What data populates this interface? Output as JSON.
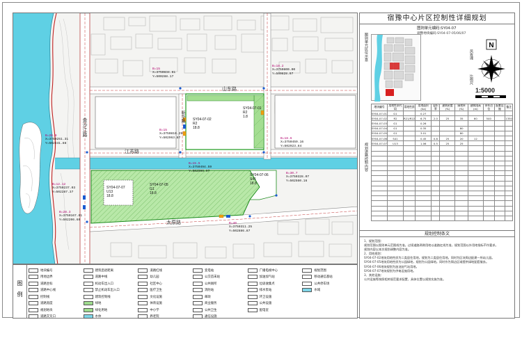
{
  "title": "宿豫中心片区控制性详细规划",
  "map_number": "图则单元编码:SY04-07",
  "map_date": "调整地块编码:SY04-07-05/06/07",
  "location_label": "图则单元区位示意",
  "north_label": "风玫瑰",
  "scale_label": "比例尺",
  "scale": "1:5000",
  "road_diagram_label": "规划道路控制内容",
  "roads": {
    "upper": "山东路",
    "middle": "江苏路",
    "lower": "太原路",
    "left_vertical": "金沙江路",
    "mid_vertical": "新华路"
  },
  "plots": [
    {
      "id": "SY04-07-01",
      "code": "R2",
      "far": "1.8"
    },
    {
      "id": "SY04-07-02",
      "code": "R2",
      "far": "18.8"
    },
    {
      "id": "SY04-07-05",
      "code": "G1",
      "far": "18.8"
    },
    {
      "id": "SY04-07-07",
      "code": "U13",
      "far": "18.8"
    },
    {
      "id": "SY04-07-06",
      "code": "S41",
      "far": "18.8"
    }
  ],
  "road_widths": [
    "B=15",
    "B=28",
    "B=15",
    "B=10",
    "B=28"
  ],
  "coords": [
    {
      "cn": "B=15",
      "x": "X=3750834.61",
      "y": "Y=500288.17"
    },
    {
      "cn": "B=15",
      "x": "X=3750810.29",
      "y": "Y=502963.87"
    },
    {
      "cn": "B=18.2",
      "x": "X=3750800.00",
      "y": "Y=500828.07"
    },
    {
      "cn": "B=28.9",
      "x": "X=3750251.31",
      "y": "Y=502241.88"
    },
    {
      "cn": "B=18.6",
      "x": "X=3750459.16",
      "y": "Y=502923.84"
    },
    {
      "cn": "B=15.5",
      "x": "X=3750494.59",
      "y": "Y=502596.97"
    },
    {
      "cn": "B=30.7",
      "x": "X=3750328.07",
      "y": "Y=502560.16"
    },
    {
      "cn": "B=12.12",
      "x": "X=3750237.03",
      "y": "Y=502287.37"
    },
    {
      "cn": "B=28.3",
      "x": "X=3750167.01",
      "y": "Y=502206.60"
    },
    {
      "cn": "B=40",
      "x": "X=3750311.25",
      "y": "Y=502886.87"
    }
  ],
  "table": {
    "headers": [
      "地块编号",
      "用地性质代码",
      "用地性质",
      "用地面积(ha)",
      "容积率",
      "建筑密度(%)",
      "绿地率(%)",
      "建筑限高(m)",
      "停车泊位",
      "配套设施",
      "备注"
    ],
    "rows": [
      [
        "SY04-07-01",
        "G1",
        "",
        "0.27",
        "",
        "",
        "",
        "",
        "",
        "",
        ""
      ],
      [
        "SY04-07-02",
        "R2",
        "R21/R22",
        "6.75",
        "2.0",
        "25",
        "35",
        "60",
        "540",
        "",
        "1350"
      ],
      [
        "SY04-07-03",
        "G1",
        "",
        "0.26",
        "",
        "",
        "",
        "",
        "",
        "",
        ""
      ],
      [
        "SY04-07-04",
        "G1",
        "",
        "0.35",
        "",
        "",
        "80",
        "",
        "",
        "",
        ""
      ],
      [
        "SY04-07-05",
        "G1",
        "",
        "3.01",
        "",
        "",
        "80",
        "",
        "",
        "",
        ""
      ],
      [
        "SY04-07-06",
        "S41",
        "",
        "0.45",
        "0.8",
        "25",
        "20",
        "12",
        "",
        "",
        ""
      ],
      [
        "SY04-07-07",
        "U13",
        "",
        "1.06",
        "0.5",
        "25",
        "25",
        "",
        "",
        "",
        ""
      ],
      [
        "",
        "",
        "",
        "",
        "",
        "",
        "",
        "",
        "",
        "",
        ""
      ],
      [
        "",
        "",
        "",
        "",
        "",
        "",
        "",
        "",
        "",
        "",
        ""
      ],
      [
        "",
        "",
        "",
        "",
        "",
        "",
        "",
        "",
        "",
        "",
        ""
      ],
      [
        "",
        "",
        "",
        "",
        "",
        "",
        "",
        "",
        "",
        "",
        ""
      ],
      [
        "",
        "",
        "",
        "",
        "",
        "",
        "",
        "",
        "",
        "",
        ""
      ],
      [
        "",
        "",
        "",
        "",
        "",
        "",
        "",
        "",
        "",
        "",
        ""
      ],
      [
        "",
        "",
        "",
        "",
        "",
        "",
        "",
        "",
        "",
        "",
        ""
      ],
      [
        "",
        "",
        "",
        "",
        "",
        "",
        "",
        "",
        "",
        "",
        ""
      ],
      [
        "",
        "",
        "",
        "",
        "",
        "",
        "",
        "",
        "",
        "",
        ""
      ],
      [
        "",
        "",
        "",
        "",
        "",
        "",
        "",
        "",
        "",
        "",
        ""
      ],
      [
        "",
        "",
        "",
        "",
        "",
        "",
        "",
        "",
        "",
        "",
        ""
      ],
      [
        "",
        "",
        "",
        "",
        "",
        "",
        "",
        "",
        "",
        "",
        ""
      ],
      [
        "",
        "",
        "",
        "",
        "",
        "",
        "",
        "",
        "",
        "",
        ""
      ],
      [
        "",
        "",
        "",
        "",
        "",
        "",
        "",
        "",
        "",
        "",
        ""
      ],
      [
        "",
        "",
        "",
        "",
        "",
        "",
        "",
        "",
        "",
        "",
        ""
      ]
    ]
  },
  "control_title": "规划控制条文",
  "notes": [
    "1、规划范围：",
    "   规划范围以图则单元范围线为准。过境道路两侧用地以道路红线为准，规划范围以外用地指标不作要求。",
    "   规划内容以本次规划调整内容为准。",
    "2、用地规划：",
    "   SY04-07-02地块用地性质为二类居住用地，规划为二类居住用地。同时为区块周边配建一所幼儿园。",
    "   SY04-07-05地块用地性质为公园绿地，规划为公园绿地。同时作为周边区域提供绿地配套服务。",
    "   SY04-07-06地块规划为加油加气站用地。",
    "   SY04-07-07地块规划为供电设施用地。",
    "3、其他设施：",
    "   公共设施等按照相关规范要求配置，具体位置以规划实施为准。"
  ],
  "legend_title": "图例",
  "legend": [
    {
      "label": "地块编号",
      "color": "#ffffff"
    },
    {
      "label": "建筑后退距离",
      "color": "#ffffff"
    },
    {
      "label": "道路红线",
      "color": "#ffffff"
    },
    {
      "label": "变电站",
      "color": "#ffffff"
    },
    {
      "label": "广播电视中心",
      "color": "#ffffff"
    },
    {
      "label": "规划范围",
      "color": "#ffffff"
    },
    {
      "label": "用地边界",
      "color": "#ffffff"
    },
    {
      "label": "道路中线",
      "color": "#ffffff"
    },
    {
      "label": "幼儿园",
      "color": "#ffffff"
    },
    {
      "label": "公交首末站",
      "color": "#ffffff"
    },
    {
      "label": "加油加气站",
      "color": "#ffffff"
    },
    {
      "label": "移动通信基站",
      "color": "#ffffff"
    },
    {
      "label": "道路坐标",
      "color": "#ffffff"
    },
    {
      "label": "机动车出入口",
      "color": "#ffffff"
    },
    {
      "label": "社区中心",
      "color": "#ffffff"
    },
    {
      "label": "公共厕所",
      "color": "#ffffff"
    },
    {
      "label": "垃圾收集点",
      "color": "#ffffff"
    },
    {
      "label": "公共停车场",
      "color": "#ffffff"
    },
    {
      "label": "道路中心线",
      "color": "#ffffff"
    },
    {
      "label": "禁止机动车出入口",
      "color": "#ffffff"
    },
    {
      "label": "医疗卫生",
      "color": "#ffffff"
    },
    {
      "label": "消防站",
      "color": "#ffffff"
    },
    {
      "label": "排水泵站",
      "color": "#ffffff"
    },
    {
      "label": "水域",
      "color": "#7fd6e8"
    },
    {
      "label": "控制线",
      "color": "#ffffff"
    },
    {
      "label": "建筑控制线",
      "color": "#ffffff"
    },
    {
      "label": "文化设施",
      "color": "#ffffff"
    },
    {
      "label": "邮政",
      "color": "#ffffff"
    },
    {
      "label": "环卫设施",
      "color": "#ffffff"
    },
    {
      "label": "",
      "color": "#ffffff"
    },
    {
      "label": "道路宽度",
      "color": "#ffffff"
    },
    {
      "label": "绿地",
      "color": "#9fdc8e"
    },
    {
      "label": "体育设施",
      "color": "#ffffff"
    },
    {
      "label": "商业服务",
      "color": "#ffffff"
    },
    {
      "label": "公共设施",
      "color": "#ffffff"
    },
    {
      "label": "",
      "color": "#ffffff"
    },
    {
      "label": "规划地块",
      "color": "#ffffff"
    },
    {
      "label": "绿化用地",
      "color": "#9fdc8e"
    },
    {
      "label": "中小学",
      "color": "#ffffff"
    },
    {
      "label": "公共卫生",
      "color": "#ffffff"
    },
    {
      "label": "配电室",
      "color": "#ffffff"
    },
    {
      "label": "",
      "color": "#ffffff"
    },
    {
      "label": "道路交叉口",
      "color": "#ffffff"
    },
    {
      "label": "水体",
      "color": "#7fd6e8"
    },
    {
      "label": "养老院",
      "color": "#ffffff"
    },
    {
      "label": "通信设施",
      "color": "#ffffff"
    },
    {
      "label": "",
      "color": "#ffffff"
    },
    {
      "label": "",
      "color": "#ffffff"
    }
  ]
}
